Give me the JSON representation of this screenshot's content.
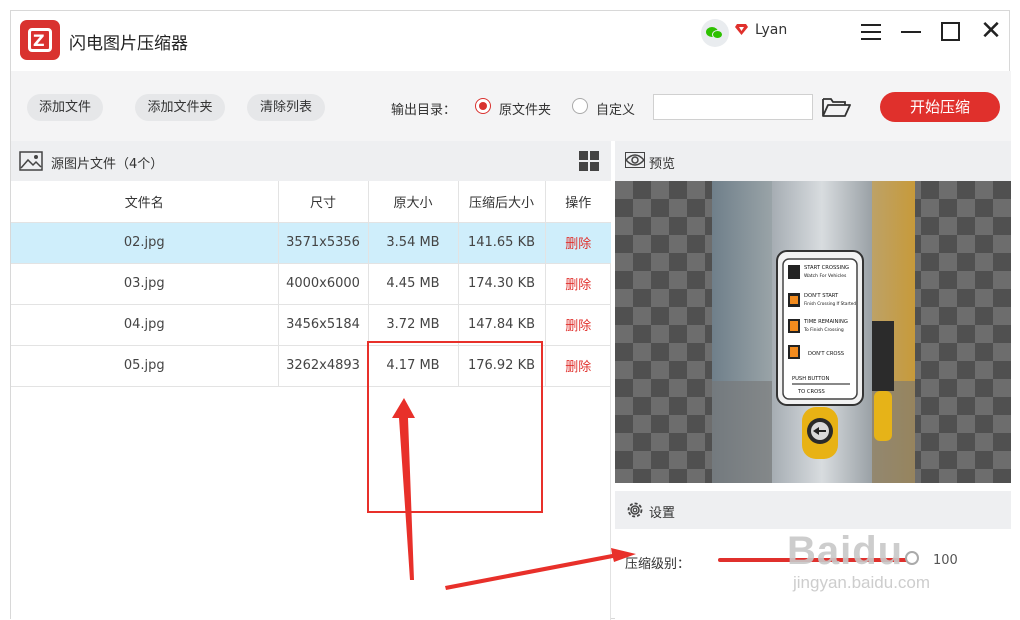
{
  "app": {
    "title": "闪电图片压缩器",
    "username": "Lyan"
  },
  "toolbar": {
    "add_file": "添加文件",
    "add_folder": "添加文件夹",
    "clear_list": "清除列表",
    "output_label": "输出目录：",
    "option_original": "原文件夹",
    "option_custom": "自定义",
    "path_value": "",
    "start": "开始压缩"
  },
  "left_panel": {
    "title": "源图片文件（4个）",
    "columns": [
      "文件名",
      "尺寸",
      "原大小",
      "压缩后大小",
      "操作"
    ],
    "rows": [
      {
        "name": "02.jpg",
        "size": "3571x5356",
        "original": "3.54 MB",
        "compressed": "141.65 KB",
        "action": "删除"
      },
      {
        "name": "03.jpg",
        "size": "4000x6000",
        "original": "4.45 MB",
        "compressed": "174.30 KB",
        "action": "删除"
      },
      {
        "name": "04.jpg",
        "size": "3456x5184",
        "original": "3.72 MB",
        "compressed": "147.84 KB",
        "action": "删除"
      },
      {
        "name": "05.jpg",
        "size": "3262x4893",
        "original": "4.17 MB",
        "compressed": "176.92 KB",
        "action": "删除"
      }
    ]
  },
  "right_panel": {
    "preview_title": "预览",
    "settings_title": "设置",
    "level_label": "压缩级别：",
    "level_value": "100",
    "sign": {
      "line1": "START CROSSING",
      "line2": "Watch For Vehicles",
      "line3": "DON'T START",
      "line4": "Finish Crossing If Started",
      "line5": "TIME REMAINING",
      "line6": "To Finish Crossing",
      "line7": "DON'T CROSS",
      "line8": "PUSH BUTTON",
      "line9": "TO CROSS"
    }
  },
  "watermark": {
    "brand": "Baidu",
    "site": "jingyan.baidu.com"
  },
  "colors": {
    "accent": "#e0302c",
    "selected_row": "#cfeefb",
    "panel_bg": "#eeeff1"
  }
}
